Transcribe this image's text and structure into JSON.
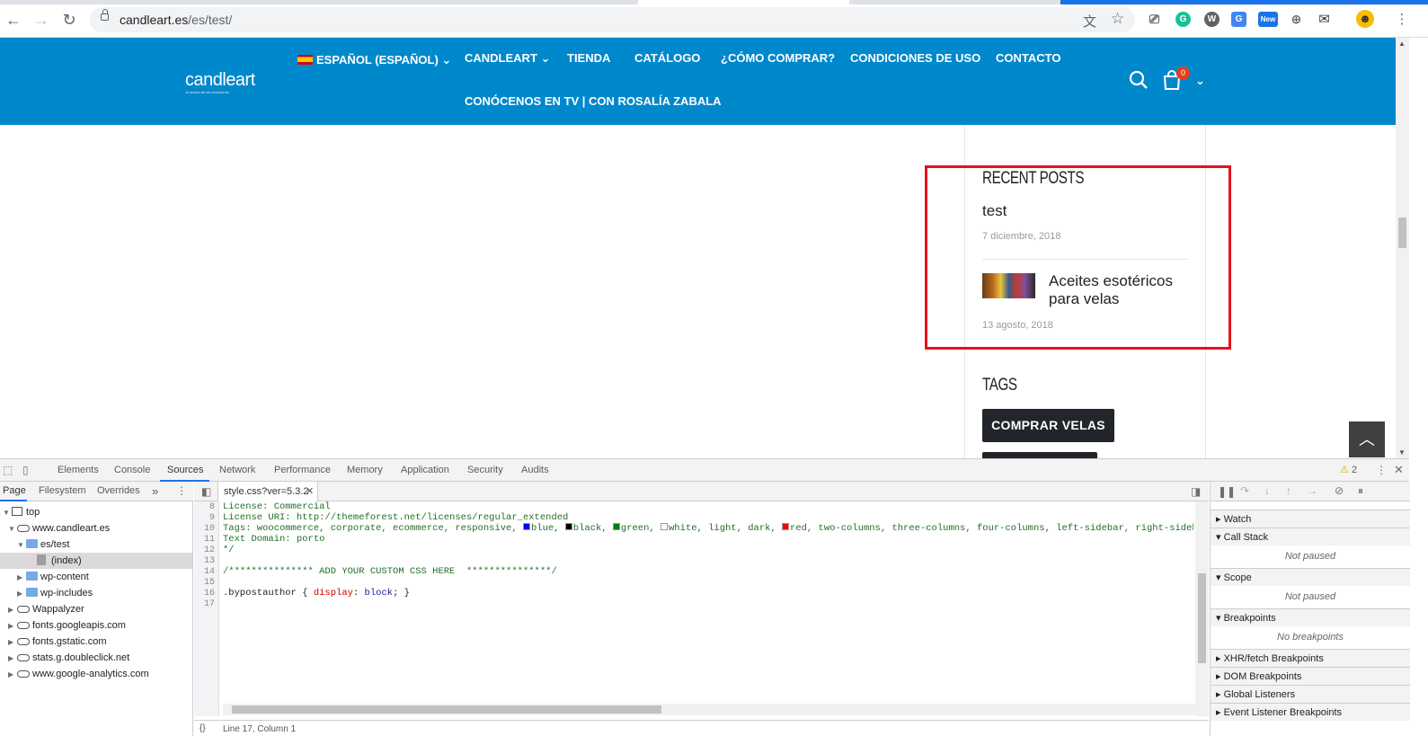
{
  "browser": {
    "url_domain": "candleart.es",
    "url_path": "/es/test/",
    "back_icon": "arrow-left",
    "forward_icon": "arrow-right",
    "reload_icon": "reload",
    "extensions": [
      {
        "name": "translate-icon",
        "glyph": "文"
      },
      {
        "name": "star-icon",
        "glyph": "☆"
      },
      {
        "name": "bus-icon",
        "glyph": "⎚"
      },
      {
        "name": "grammarly-icon",
        "glyph": "G"
      },
      {
        "name": "wordpress-icon",
        "glyph": "W"
      },
      {
        "name": "google-translate-icon",
        "glyph": "G"
      },
      {
        "name": "new-badge-icon",
        "glyph": "New"
      },
      {
        "name": "globe-icon",
        "glyph": "⊕"
      },
      {
        "name": "mail-icon",
        "glyph": "✉"
      },
      {
        "name": "avatar-icon",
        "glyph": "☻"
      }
    ]
  },
  "site": {
    "logo": "candleart",
    "logo_tagline": "el aroma de las emociones",
    "menu": [
      {
        "label": "ESPAÑOL (ESPAÑOL)",
        "has_dropdown": true
      },
      {
        "label": "CANDLEART",
        "has_dropdown": true
      },
      {
        "label": "TIENDA"
      },
      {
        "label": "CATÁLOGO"
      },
      {
        "label": "¿CÓMO COMPRAR?"
      },
      {
        "label": "CONDICIONES DE USO"
      },
      {
        "label": "CONTACTO"
      },
      {
        "label": "CONÓCENOS EN TV | CON ROSALÍA ZABALA"
      }
    ],
    "cart_count": "0",
    "colors": {
      "header": "#0088cc",
      "highlight": "#e4121e"
    }
  },
  "sidebar": {
    "recent_posts_title": "RECENT POSTS",
    "posts": [
      {
        "title": "test",
        "date": "7 diciembre, 2018"
      },
      {
        "title": "Aceites esotéricos para velas",
        "date": "13 agosto, 2018"
      }
    ],
    "tags_title": "TAGS",
    "tags": [
      "COMPRAR VELAS"
    ]
  },
  "devtools": {
    "tabs": [
      "Elements",
      "Console",
      "Sources",
      "Network",
      "Performance",
      "Memory",
      "Application",
      "Security",
      "Audits"
    ],
    "active_tab": "Sources",
    "warnings": "2",
    "navigator_tabs": [
      "Page",
      "Filesystem",
      "Overrides"
    ],
    "more_tabs": "»",
    "tree": [
      {
        "label": "top",
        "level": 0,
        "type": "frame",
        "expanded": true
      },
      {
        "label": "www.candleart.es",
        "level": 1,
        "type": "cloud",
        "expanded": true
      },
      {
        "label": "es/test",
        "level": 2,
        "type": "folder",
        "expanded": true
      },
      {
        "label": "(index)",
        "level": 3,
        "type": "file",
        "selected": true
      },
      {
        "label": "wp-content",
        "level": 2,
        "type": "folder"
      },
      {
        "label": "wp-includes",
        "level": 2,
        "type": "folder"
      },
      {
        "label": "Wappalyzer",
        "level": 1,
        "type": "cloud"
      },
      {
        "label": "fonts.googleapis.com",
        "level": 1,
        "type": "cloud"
      },
      {
        "label": "fonts.gstatic.com",
        "level": 1,
        "type": "cloud"
      },
      {
        "label": "stats.g.doubleclick.net",
        "level": 1,
        "type": "cloud"
      },
      {
        "label": "www.google-analytics.com",
        "level": 1,
        "type": "cloud"
      }
    ],
    "editor_tab": "style.css?ver=5.3.2",
    "code_lines": [
      {
        "n": "8",
        "text": "License: Commercial"
      },
      {
        "n": "9",
        "text": "License URI: http://themeforest.net/licenses/regular_extended"
      },
      {
        "n": "10",
        "text": "Tags: woocommerce, corporate, ecommerce, responsive, "
      },
      {
        "n": "11",
        "text": "Text Domain: porto"
      },
      {
        "n": "12",
        "text": "*/"
      },
      {
        "n": "13",
        "text": ""
      },
      {
        "n": "14",
        "text": "/*************** ADD YOUR CUSTOM CSS HERE  ***************/"
      },
      {
        "n": "15",
        "text": ""
      },
      {
        "n": "16",
        "text": ""
      },
      {
        "n": "17",
        "text": ""
      }
    ],
    "tags_line": {
      "swatches": [
        {
          "label": "blue, ",
          "color": "#0000ff"
        },
        {
          "label": "black, ",
          "color": "#000000"
        },
        {
          "label": "green, ",
          "color": "#008000"
        },
        {
          "label": "white, light, dark, ",
          "color": "#ffffff"
        },
        {
          "label": "red, two-columns, three-columns, four-columns, left-sidebar, right-sidebar, fixed-",
          "color": "#ff0000"
        }
      ]
    },
    "css_rule": {
      "selector": ".bypostauthor",
      "open": " { ",
      "property": "display",
      "colon": ": ",
      "value": "block",
      "close": "; }"
    },
    "status": "Line 17, Column 1",
    "debug_sections": [
      {
        "title": "Watch",
        "expanded": false
      },
      {
        "title": "Call Stack",
        "expanded": true,
        "body": "Not paused"
      },
      {
        "title": "Scope",
        "expanded": true,
        "body": "Not paused"
      },
      {
        "title": "Breakpoints",
        "expanded": true,
        "body": "No breakpoints"
      },
      {
        "title": "XHR/fetch Breakpoints",
        "expanded": false
      },
      {
        "title": "DOM Breakpoints",
        "expanded": false
      },
      {
        "title": "Global Listeners",
        "expanded": false
      },
      {
        "title": "Event Listener Breakpoints",
        "expanded": false
      }
    ]
  }
}
